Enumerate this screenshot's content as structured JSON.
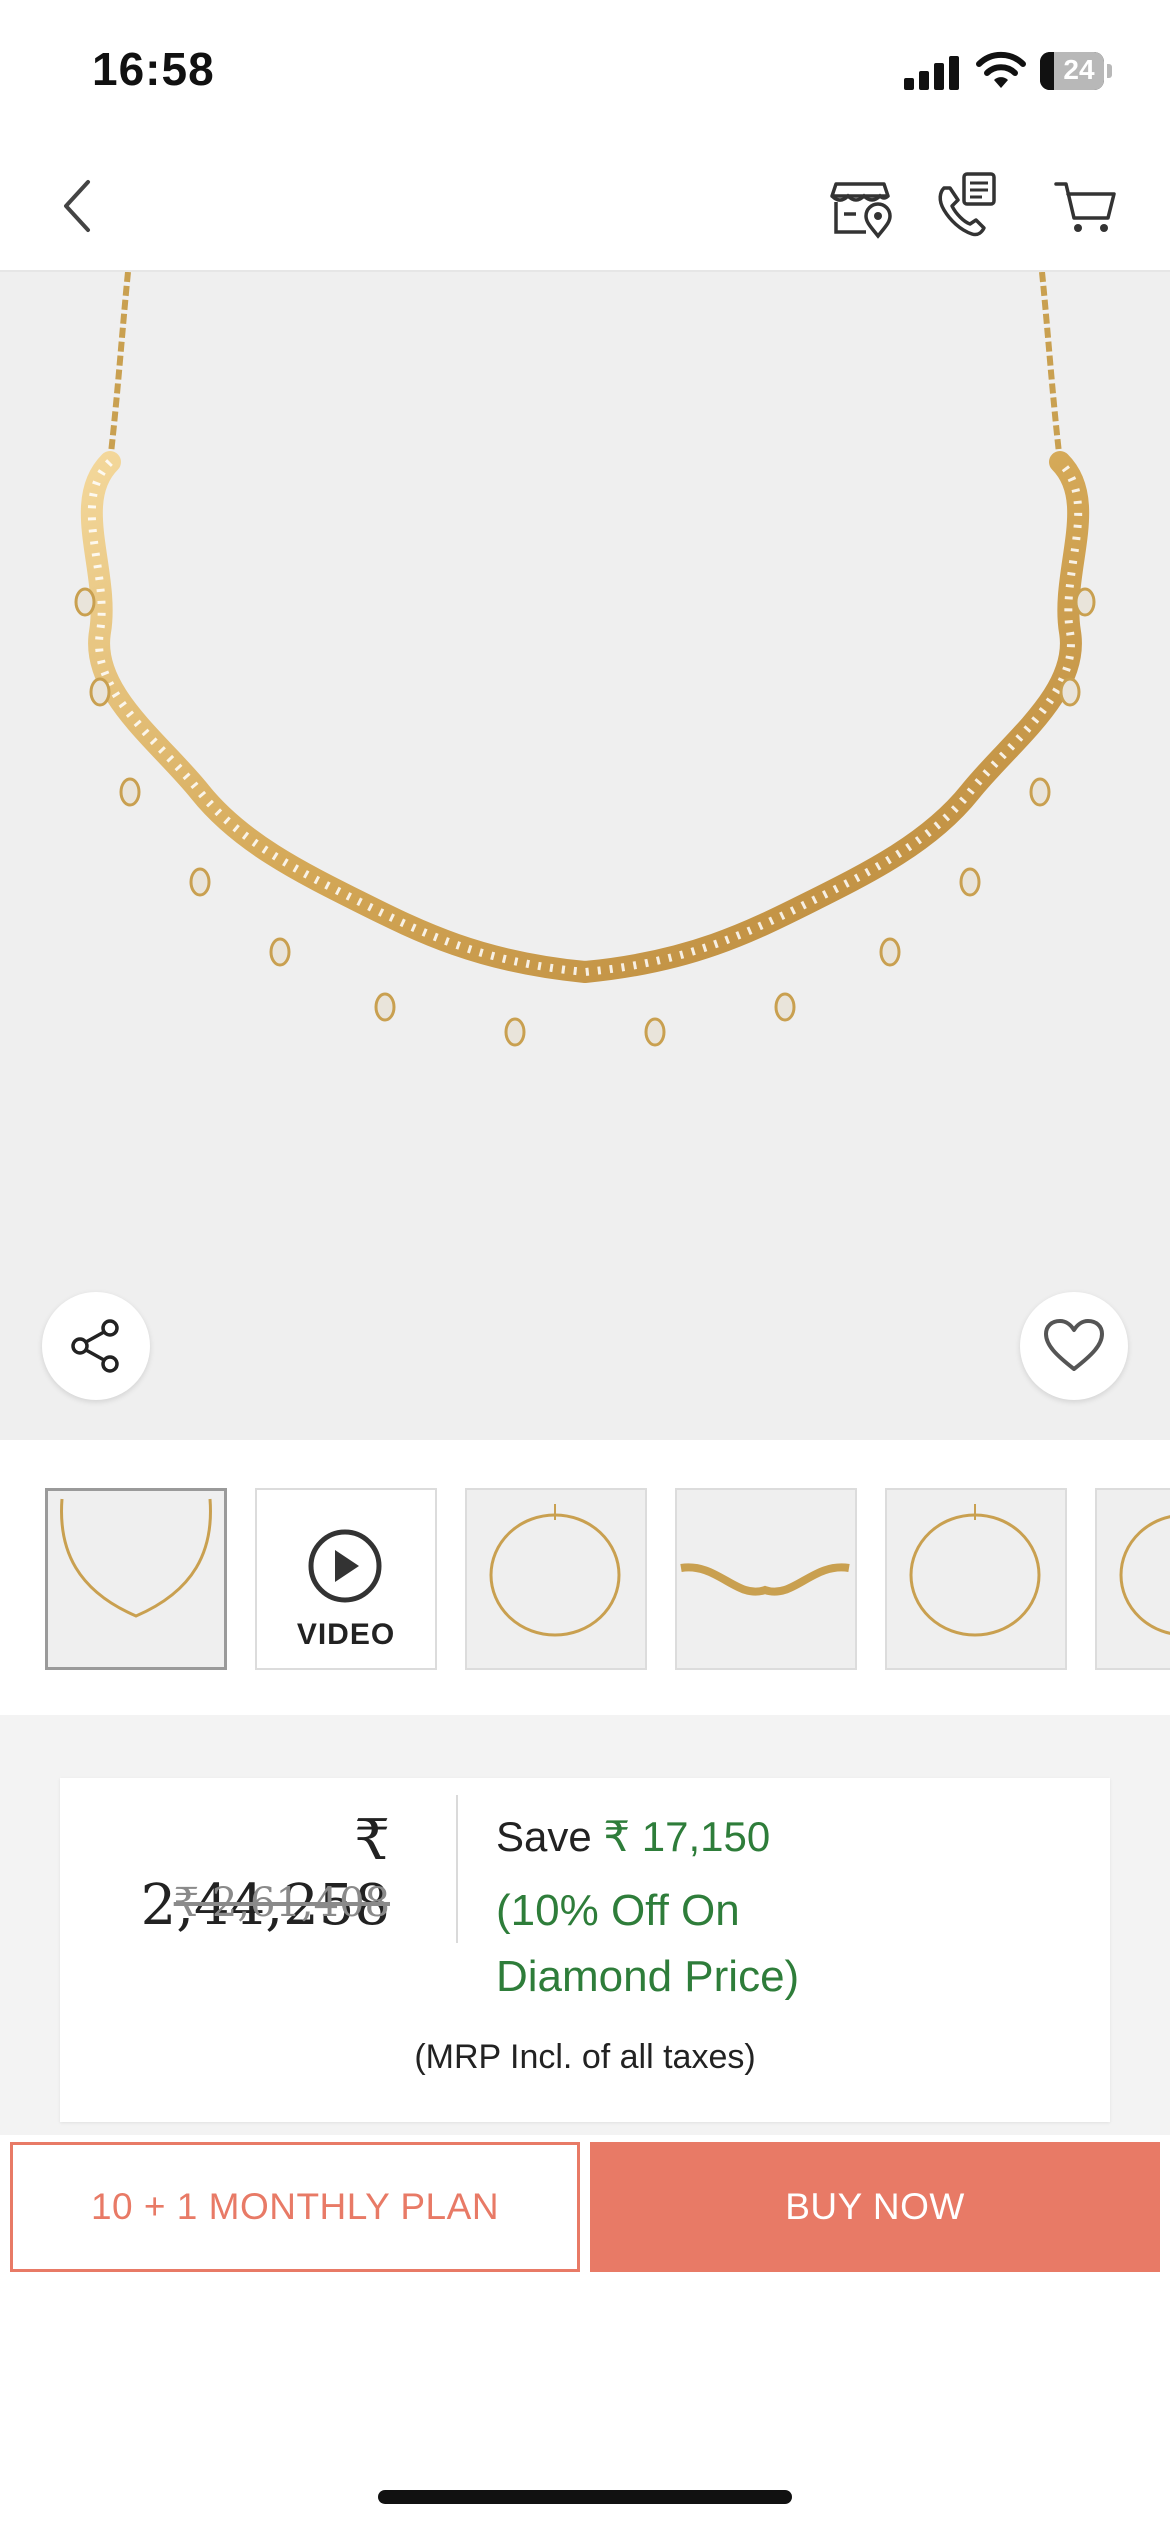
{
  "status_bar": {
    "time": "16:58",
    "battery": "24"
  },
  "nav": {
    "icons": [
      "back-icon",
      "store-locator-icon",
      "call-icon",
      "cart-icon"
    ]
  },
  "hero": {
    "icons": [
      "share-icon",
      "heart-icon"
    ]
  },
  "thumbnails": [
    {
      "type": "image",
      "active": true
    },
    {
      "type": "video",
      "label": "VIDEO"
    },
    {
      "type": "image"
    },
    {
      "type": "image"
    },
    {
      "type": "image"
    },
    {
      "type": "image"
    }
  ],
  "price": {
    "current": "₹ 2,44,258",
    "original": "₹ 2,61,408",
    "save_label": "Save",
    "save_amount": "₹ 17,150",
    "discount_line1": "(10% Off On",
    "discount_line2": "Diamond Price)",
    "mrp_note": "(MRP Incl. of all taxes)"
  },
  "actions": {
    "plan_label": "10 + 1 MONTHLY PLAN",
    "buy_label": "BUY NOW"
  },
  "colors": {
    "accent": "#e87a66",
    "save_green": "#2e7d3a",
    "hero_bg": "#efefef",
    "gold": "#d9b36a"
  }
}
